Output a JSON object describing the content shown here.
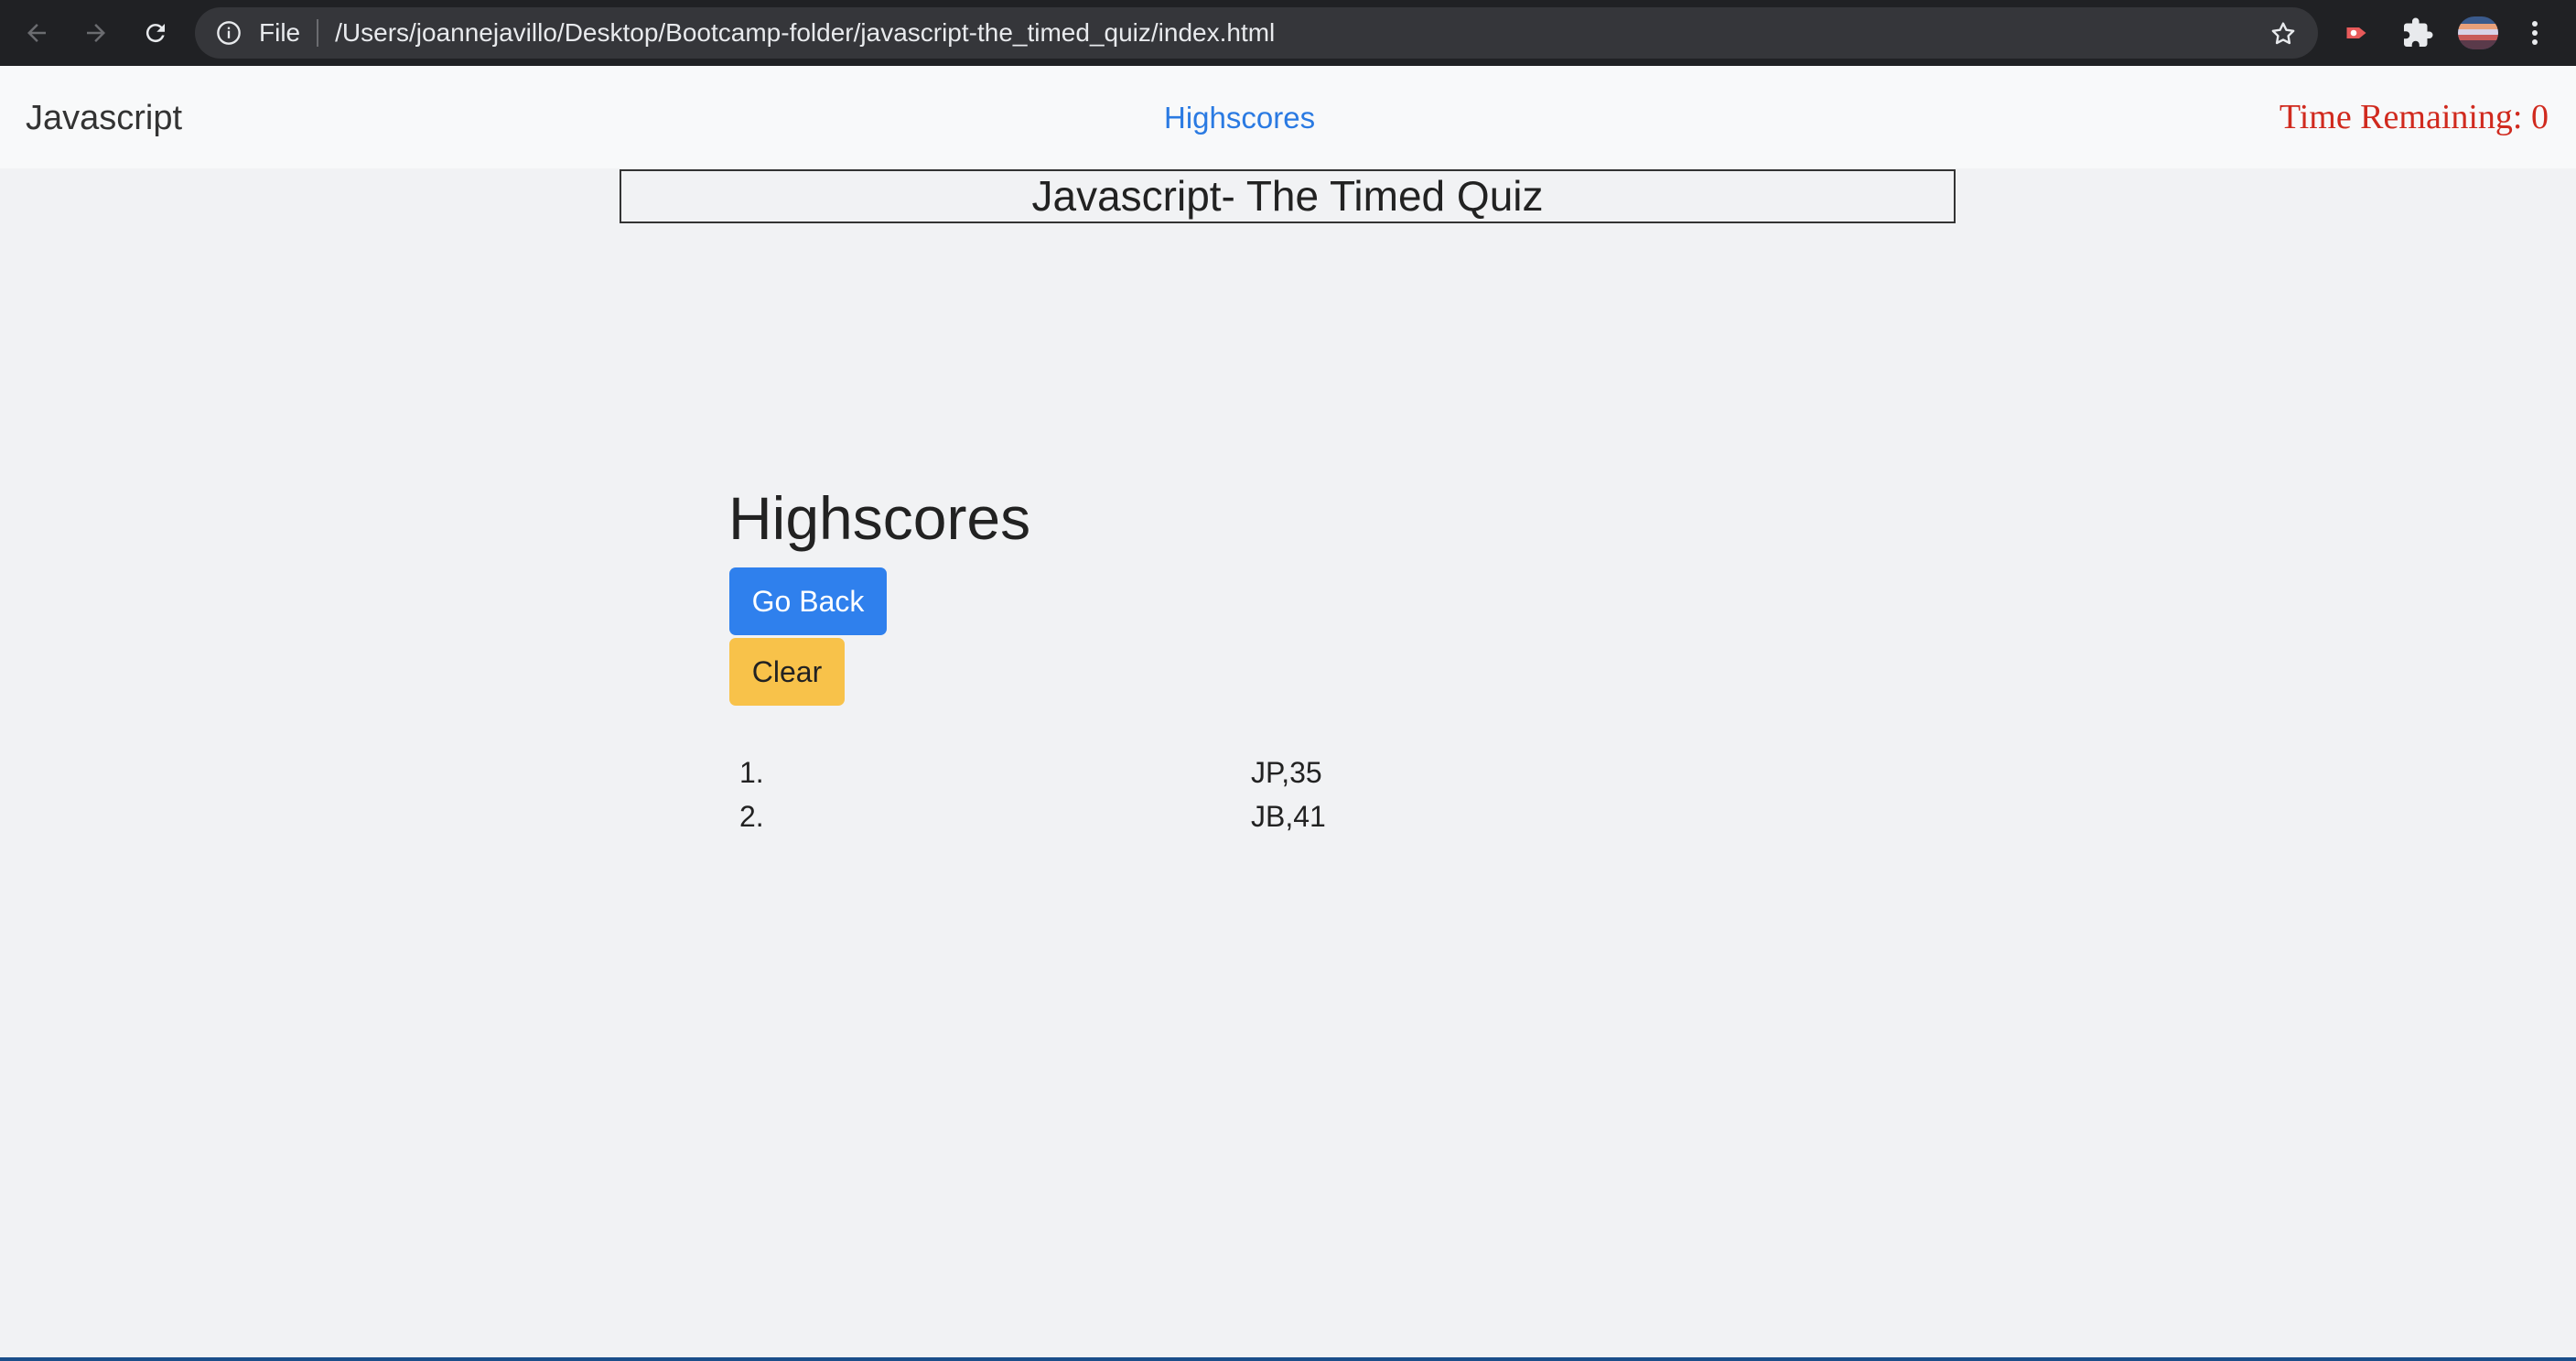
{
  "browser": {
    "omnibox_scheme": "File",
    "url": "/Users/joannejavillo/Desktop/Bootcamp-folder/javascript-the_timed_quiz/index.html",
    "icons": [
      "back-arrow-icon",
      "forward-arrow-icon",
      "reload-icon",
      "info-icon",
      "star-icon",
      "extension-icon",
      "puzzle-icon",
      "profile-avatar",
      "menu-icon"
    ]
  },
  "navbar": {
    "brand": "Javascript",
    "link": "Highscores",
    "timer": "Time Remaining: 0",
    "timer_color": "#d02a1e",
    "link_color": "#2a7ae2"
  },
  "page": {
    "title": "Javascript- The Timed Quiz"
  },
  "highscores": {
    "heading": "Highscores",
    "go_back_label": "Go Back",
    "clear_label": "Clear",
    "go_back_color": "#2f80ed",
    "clear_color": "#f8c24a",
    "entries": [
      {
        "rank": "1.",
        "value": "JP,35"
      },
      {
        "rank": "2.",
        "value": "JB,41"
      }
    ]
  }
}
